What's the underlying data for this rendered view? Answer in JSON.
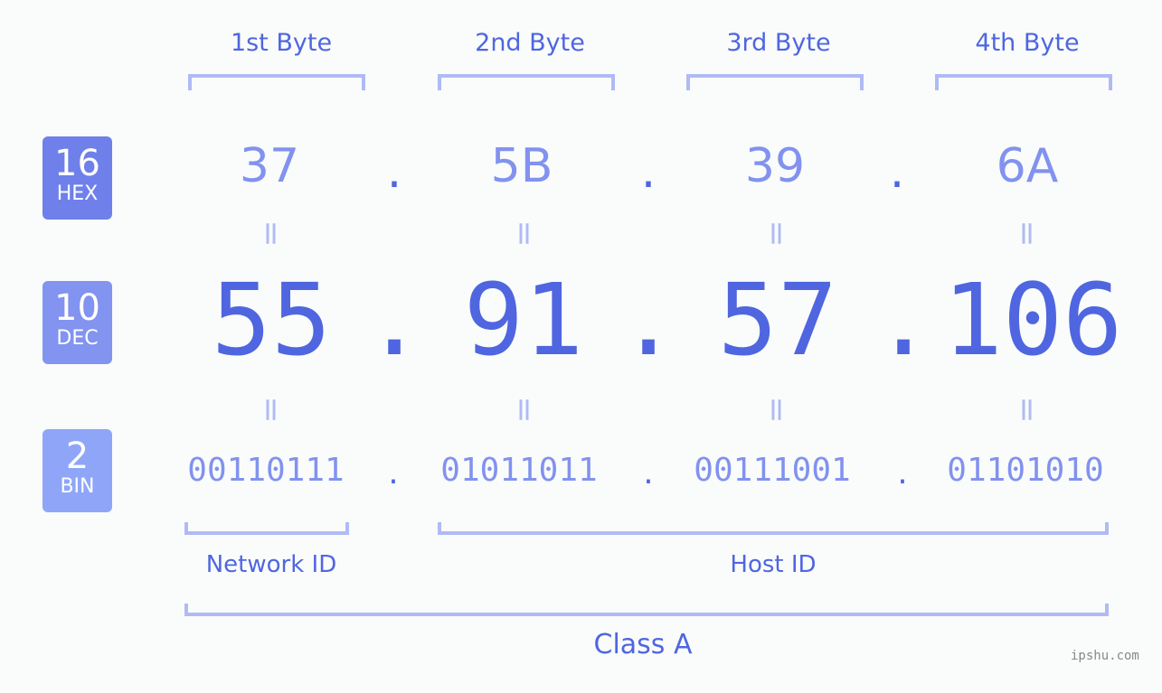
{
  "headers": [
    "1st Byte",
    "2nd Byte",
    "3rd Byte",
    "4th Byte"
  ],
  "badges": [
    {
      "num": "16",
      "label": "HEX",
      "color": "#6f80ea"
    },
    {
      "num": "10",
      "label": "DEC",
      "color": "#8293f0"
    },
    {
      "num": "2",
      "label": "BIN",
      "color": "#8fa6f8"
    }
  ],
  "hex": [
    "37",
    "5B",
    "39",
    "6A"
  ],
  "dec": [
    "55",
    "91",
    "57",
    "106"
  ],
  "bin": [
    "00110111",
    "01011011",
    "00111001",
    "01101010"
  ],
  "separator": ".",
  "equals": "=",
  "network_label": "Network ID",
  "host_label": "Host ID",
  "class_label": "Class A",
  "watermark": "ipshu.com"
}
